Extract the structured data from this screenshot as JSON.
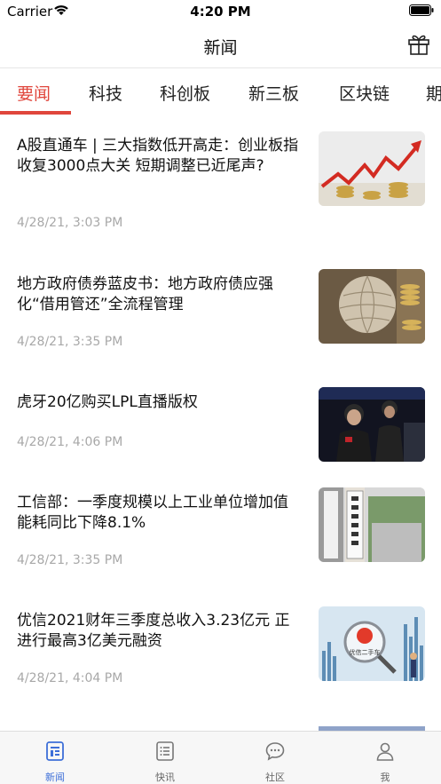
{
  "status_bar": {
    "carrier": "Carrier",
    "time": "4:20 PM"
  },
  "nav": {
    "title": "新闻",
    "gift_icon": "gift-icon"
  },
  "tabs": [
    {
      "label": "要闻",
      "active": true
    },
    {
      "label": "科技",
      "active": false
    },
    {
      "label": "科创板",
      "active": false
    },
    {
      "label": "新三板",
      "active": false
    },
    {
      "label": "区块链",
      "active": false
    },
    {
      "label": "期",
      "active": false
    }
  ],
  "news": [
    {
      "title": "A股直通车 | 三大指数低开高走：创业板指收复3000点大关 短期调整已近尾声?",
      "time": "4/28/21, 3:03 PM",
      "thumb": "stock-chart-coins"
    },
    {
      "title": "地方政府债券蓝皮书：地方政府债应强化“借用管还”全流程管理",
      "time": "4/28/21, 3:35 PM",
      "thumb": "globe-coins"
    },
    {
      "title": "虎牙20亿购买LPL直播版权",
      "time": "4/28/21, 4:06 PM",
      "thumb": "esports-players"
    },
    {
      "title": "工信部：一季度规模以上工业单位增加值能耗同比下降8.1%",
      "time": "4/28/21, 3:35 PM",
      "thumb": "ministry-sign"
    },
    {
      "title": "优信2021财年三季度总收入3.23亿元 正进行最高3亿美元融资",
      "time": "4/28/21, 4:04 PM",
      "thumb": "uxin-logo-magnifier",
      "badge": "优信二手车"
    }
  ],
  "tabbar": [
    {
      "label": "新闻",
      "icon": "news-icon",
      "active": true
    },
    {
      "label": "快讯",
      "icon": "flash-list-icon",
      "active": false
    },
    {
      "label": "社区",
      "icon": "chat-bubble-icon",
      "active": false
    },
    {
      "label": "我",
      "icon": "person-icon",
      "active": false
    }
  ],
  "colors": {
    "accent": "#e0463c",
    "tabbar_active": "#3d6fd8",
    "time_gray": "#a8a8a8"
  }
}
